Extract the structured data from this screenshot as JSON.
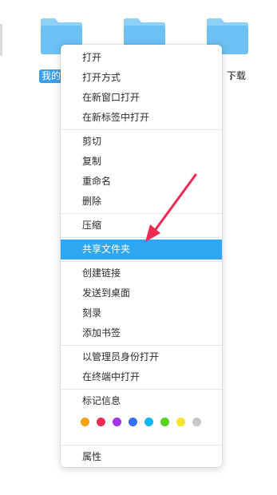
{
  "desktop": {
    "folders": [
      {
        "label": "我的",
        "selected": true
      },
      {
        "label": "",
        "selected": false
      },
      {
        "label": "下载",
        "selected": false
      }
    ],
    "partial_label_fragment": "",
    "colors": {
      "folder_top": "#8fd0f7",
      "folder_body": "#6cc0f4",
      "selection": "#3a9fe8"
    }
  },
  "context_menu": {
    "groups": [
      [
        {
          "label": "打开",
          "icon": "",
          "submenu": false
        },
        {
          "label": "打开方式",
          "icon": "",
          "submenu": true
        },
        {
          "label": "在新窗口打开",
          "icon": "",
          "submenu": false
        },
        {
          "label": "在新标签中打开",
          "icon": "",
          "submenu": false
        }
      ],
      [
        {
          "label": "剪切",
          "submenu": false
        },
        {
          "label": "复制",
          "submenu": false
        },
        {
          "label": "重命名",
          "submenu": false
        },
        {
          "label": "删除",
          "submenu": false
        }
      ],
      [
        {
          "label": "压缩",
          "submenu": false
        }
      ],
      [
        {
          "label": "共享文件夹",
          "submenu": false,
          "highlighted": true
        }
      ],
      [
        {
          "label": "创建链接",
          "submenu": false
        },
        {
          "label": "发送到桌面",
          "submenu": false
        },
        {
          "label": "刻录",
          "submenu": false
        },
        {
          "label": "添加书签",
          "submenu": false
        }
      ],
      [
        {
          "label": "以管理员身份打开",
          "submenu": false
        },
        {
          "label": "在终端中打开",
          "submenu": false
        }
      ]
    ],
    "tags": {
      "label": "标记信息",
      "colors": [
        "#f5a313",
        "#ee2c56",
        "#a233e8",
        "#3470f0",
        "#13b5f2",
        "#57d21c",
        "#f7e22d",
        "#c8c8c8"
      ]
    },
    "properties_label": "属性",
    "highlight_color": "#2ea6f2"
  },
  "annotation": {
    "color": "#ee2a53"
  }
}
